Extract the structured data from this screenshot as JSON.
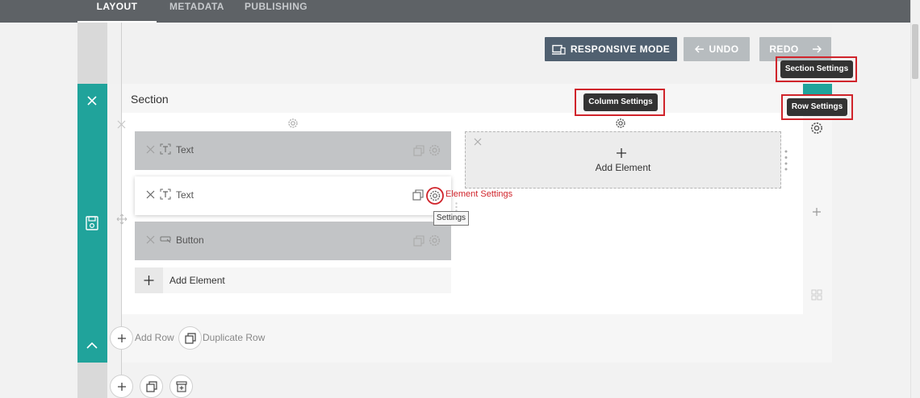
{
  "nav": {
    "tabs": [
      {
        "label": "LAYOUT",
        "active": true
      },
      {
        "label": "METADATA",
        "active": false
      },
      {
        "label": "PUBLISHING",
        "active": false
      }
    ]
  },
  "toolbar": {
    "responsive_label": "RESPONSIVE MODE",
    "undo_label": "UNDO",
    "redo_label": "REDO"
  },
  "section": {
    "title": "Section"
  },
  "elements": [
    {
      "label": "Text",
      "icon": "text-icon",
      "state": "inactive"
    },
    {
      "label": "Text",
      "icon": "text-icon",
      "state": "active"
    },
    {
      "label": "Button",
      "icon": "button-icon",
      "state": "inactive"
    }
  ],
  "column1": {
    "add_element_label": "Add Element"
  },
  "column2": {
    "add_element_label": "Add Element"
  },
  "tooltips": {
    "section_settings": "Section Settings",
    "row_settings": "Row Settings",
    "column_settings": "Column Settings",
    "settings": "Settings"
  },
  "annotation": {
    "element_settings": "Element Settings"
  },
  "footer": {
    "add_row": "Add Row",
    "duplicate_row": "Duplicate Row"
  },
  "colors": {
    "teal": "#20a39b",
    "nav_bg": "#5e6266",
    "responsive_btn": "#506070",
    "annotation_red": "#d0242b"
  }
}
